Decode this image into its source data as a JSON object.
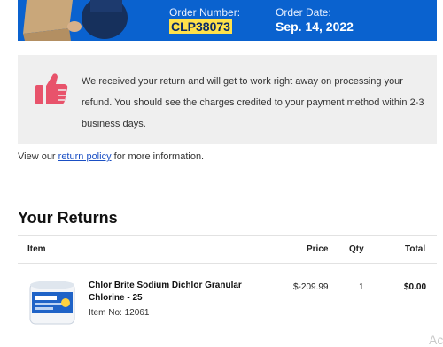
{
  "header": {
    "order_number_label": "Order Number:",
    "order_number": "CLP38073",
    "order_date_label": "Order Date:",
    "order_date": "Sep. 14, 2022",
    "banner_color": "#0a62cf",
    "highlight_color": "#ffe14a"
  },
  "message": {
    "icon": "thumbs-up-icon",
    "icon_color": "#e8536b",
    "text": "We received your return and will get to work right away on processing your refund. You should see the charges credited to your payment method within 2-3 business days."
  },
  "policy": {
    "prefix": "View our ",
    "link_text": "return policy",
    "suffix": " for more information."
  },
  "returns": {
    "title": "Your Returns",
    "columns": [
      "Item",
      "Price",
      "Qty",
      "Total"
    ],
    "rows": [
      {
        "name": "Chlor Brite Sodium Dichlor Granular Chlorine - 25",
        "item_no": "Item No: 12061",
        "price": "$-209.99",
        "qty": "1",
        "total": "$0.00"
      }
    ]
  },
  "watermark": "Ac"
}
